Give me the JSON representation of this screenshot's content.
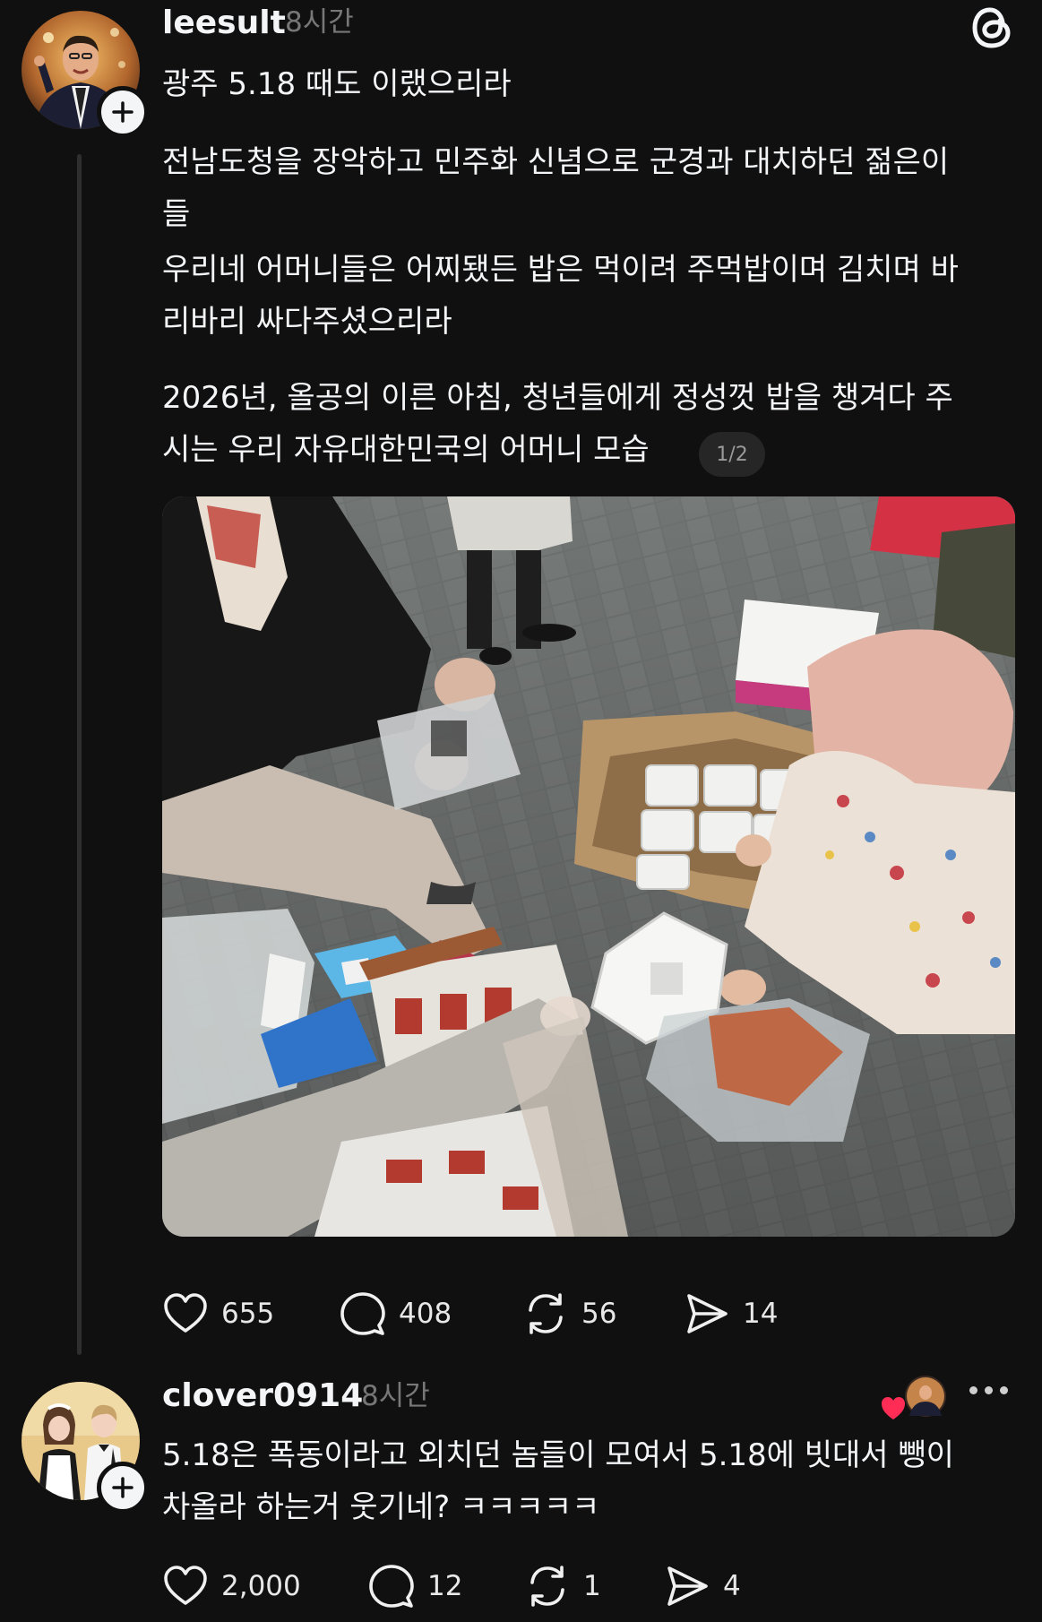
{
  "post": {
    "username": "leesult",
    "time": "8시간",
    "lines": [
      "광주 5.18 때도 이랬으리라",
      "전남도청을 장악하고 민주화 신념으로 군경과 대치하던 젊은이",
      "들",
      "우리네 어머니들은 어찌됐든 밥은 먹이려 주먹밥이며 김치며 바",
      "리바리 싸다주셨으리라",
      "2026년, 올공의 이른 아침, 청년들에게 정성껏 밥을 챙겨다 주",
      "시는 우리 자유대한민국의 어머니 모습"
    ],
    "media_counter": "1/2",
    "stats": {
      "likes": "655",
      "replies": "408",
      "reposts": "56",
      "shares": "14"
    }
  },
  "reply": {
    "username": "clover0914",
    "time": "8시간",
    "lines": [
      "5.18은 폭동이라고 외치던 놈들이 모여서 5.18에 빗대서 뺑이",
      "차올라 하는거 웃기네? ㅋㅋㅋㅋㅋ"
    ],
    "stats": {
      "likes": "2,000",
      "replies": "12",
      "reposts": "1",
      "shares": "4"
    }
  },
  "icons": {
    "like": "heart-icon",
    "reply": "comment-icon",
    "repost": "repost-icon",
    "share": "send-icon",
    "app": "threads-logo-icon",
    "menu": "more-icon",
    "follow": "plus-icon"
  },
  "colors": {
    "background": "#101010",
    "text": "#f3f5f7",
    "muted": "#777777",
    "liked_heart": "#ff2d55"
  }
}
